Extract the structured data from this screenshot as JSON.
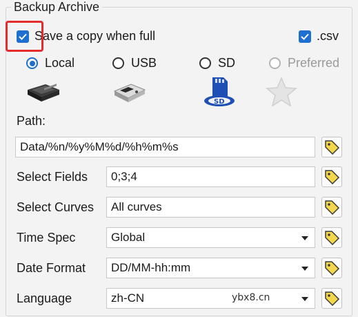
{
  "group_title": "Backup Archive",
  "save_copy": {
    "label": "Save a copy when full",
    "checked": true
  },
  "csv": {
    "label": ".csv",
    "checked": true
  },
  "storage_options": [
    {
      "label": "Local",
      "selected": true,
      "enabled": true,
      "icon": "hard-drive-icon"
    },
    {
      "label": "USB",
      "selected": false,
      "enabled": true,
      "icon": "usb-drive-icon"
    },
    {
      "label": "SD",
      "selected": false,
      "enabled": true,
      "icon": "sd-card-icon"
    },
    {
      "label": "Preferred",
      "selected": false,
      "enabled": false,
      "icon": "star-icon"
    }
  ],
  "path": {
    "label": "Path:",
    "value": "Data/%n/%y%M%d/%h%m%s"
  },
  "select_fields": {
    "label": "Select Fields",
    "value": "0;3;4"
  },
  "select_curves": {
    "label": "Select Curves",
    "value": "All curves"
  },
  "time_spec": {
    "label": "Time Spec",
    "value": "Global"
  },
  "date_format": {
    "label": "Date Format",
    "value": "DD/MM-hh:mm"
  },
  "language": {
    "label": "Language",
    "value": "zh-CN"
  },
  "watermark": "ybx8.cn",
  "colors": {
    "accent": "#1f6fd1",
    "highlight": "#e52b2b",
    "tag": "#f2d64b"
  }
}
